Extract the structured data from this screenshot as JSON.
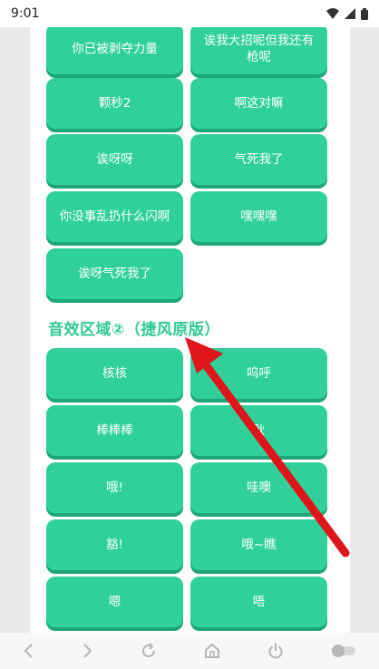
{
  "status_bar": {
    "time": "9:01"
  },
  "buttons_top": [
    "你已被剥夺力量",
    "诶我大招呢但我还有枪呢",
    "颗秒2",
    "啊这对嘛",
    "诶呀呀",
    "气死我了",
    "你没事乱扔什么闪啊",
    "嘿嘿嘿",
    "诶呀气死我了"
  ],
  "section": {
    "title": "音效区域②（捷风原版）"
  },
  "buttons_bottom": [
    "核核",
    "呜呼",
    "棒棒棒",
    "耿",
    "哦!",
    "哇噢",
    "豁!",
    "哦~瞧",
    "嗯",
    "唔"
  ],
  "colors": {
    "accent": "#2fd09a",
    "title": "#2fc994",
    "arrow": "#e0151b"
  },
  "nav_icons": [
    "back-icon",
    "forward-icon",
    "refresh-icon",
    "home-icon",
    "power-icon",
    "toggle-icon"
  ]
}
